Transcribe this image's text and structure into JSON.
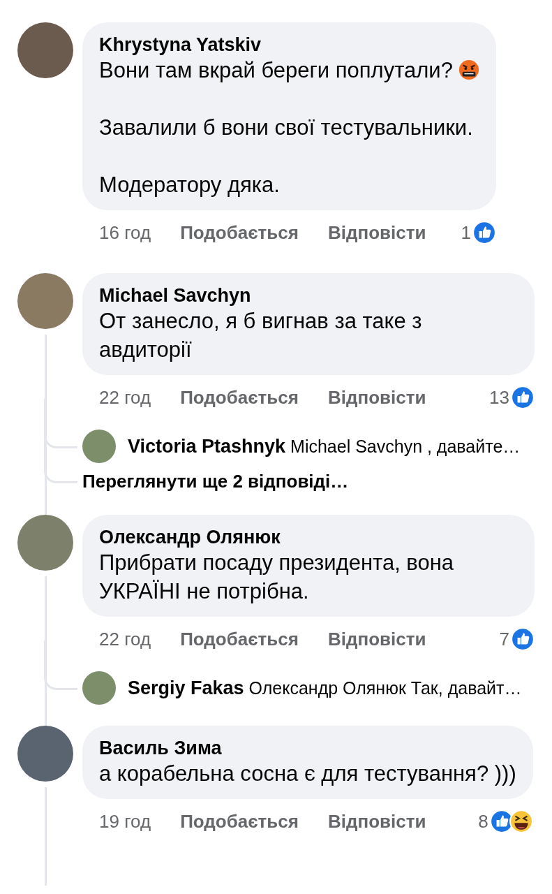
{
  "comments": [
    {
      "author": "Khrystyna Yatskiv",
      "paragraphs": [
        {
          "text": "Вони там вкрай береги поплутали?",
          "emoji": true
        },
        {
          "text": "Завалили б вони свої тестувальники.",
          "emoji": false
        },
        {
          "text": "Модератору дяка.",
          "emoji": false
        }
      ],
      "time": "16 год",
      "like": "Подобається",
      "reply": "Відповісти",
      "count": "1",
      "reactions": [
        {
          "kind": "like"
        }
      ],
      "thread_line": false
    },
    {
      "author": "Michael Savchyn",
      "paragraphs": [
        {
          "text": "От занесло, я б вигнав за таке з авдиторії",
          "emoji": false
        }
      ],
      "time": "22 год",
      "like": "Подобається",
      "reply": "Відповісти",
      "count": "13",
      "reactions": [
        {
          "kind": "like"
        }
      ],
      "thread_line": true,
      "replies": [
        {
          "author": "Victoria Ptashnyk",
          "text": "Michael Savchyn , давайте…"
        }
      ],
      "more_replies": "Переглянути ще 2 відповіді…"
    },
    {
      "author": "Олександр Олянюк",
      "paragraphs": [
        {
          "text": "Прибрати посаду президента, вона УКРАЇНІ не потрібна.",
          "emoji": false
        }
      ],
      "time": "22 год",
      "like": "Подобається",
      "reply": "Відповісти",
      "count": "7",
      "reactions": [
        {
          "kind": "like"
        }
      ],
      "thread_line": true,
      "replies": [
        {
          "author": "Sergiy Fakas",
          "text": "Олександр Олянюк Так, давайт…"
        }
      ]
    },
    {
      "author": "Василь Зима",
      "paragraphs": [
        {
          "text": "а корабельна сосна є для тестування? )))",
          "emoji": false
        }
      ],
      "time": "19 год",
      "like": "Подобається",
      "reply": "Відповісти",
      "count": "8",
      "reactions": [
        {
          "kind": "like"
        },
        {
          "kind": "haha"
        }
      ],
      "thread_line": true
    }
  ]
}
